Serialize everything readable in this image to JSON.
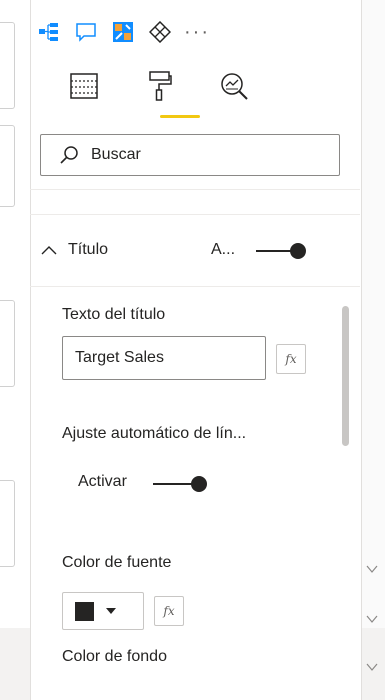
{
  "toolbar": {
    "icons": [
      "hierarchy-icon",
      "comment-icon",
      "key-influencers-icon",
      "decomposition-icon",
      "more-options-icon"
    ],
    "more_label": "···"
  },
  "tabs": [
    {
      "name": "fields",
      "icon": "table-fields-icon"
    },
    {
      "name": "format",
      "icon": "paint-roller-icon",
      "active": true
    },
    {
      "name": "analytics",
      "icon": "analytics-magnifier-icon"
    }
  ],
  "search": {
    "placeholder": "Buscar"
  },
  "section": {
    "title": "Título",
    "toggle_label": "A...",
    "toggle_on": true
  },
  "fields": {
    "title_text_label": "Texto del título",
    "title_text_value": "Target Sales",
    "fx_label": "fx",
    "word_wrap_label": "Ajuste automático de lín...",
    "activate_label": "Activar",
    "activate_on": true,
    "font_color_label": "Color de fuente",
    "font_color": "#252423",
    "bg_color_label": "Color de fondo"
  },
  "colors": {
    "accent": "#f2c811",
    "border": "#8a8886",
    "toggle": "#252423"
  }
}
